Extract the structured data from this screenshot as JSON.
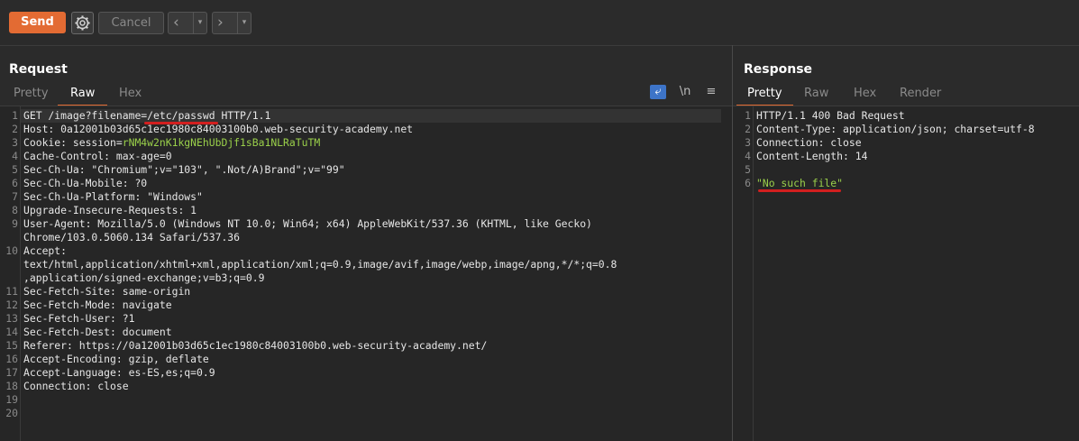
{
  "toolbar": {
    "send_label": "Send",
    "cancel_label": "Cancel",
    "back_icon": "‹",
    "forward_icon": "›",
    "dropdown_icon": "▾"
  },
  "request": {
    "title": "Request",
    "tabs": [
      "Pretty",
      "Raw",
      "Hex"
    ],
    "active_tab": "Raw",
    "icons": {
      "wrap": "⤶",
      "newline": "\\n",
      "menu": "≡"
    },
    "line_numbers": [
      "1",
      "2",
      "3",
      "4",
      "5",
      "6",
      "7",
      "8",
      "9",
      "",
      "10",
      "",
      "",
      "11",
      "12",
      "13",
      "14",
      "15",
      "16",
      "17",
      "18",
      "19",
      "20"
    ],
    "lines": [
      {
        "prefix": "GET /image?filename=",
        "highlight": "/etc/passwd",
        "suffix": " HTTP/1.1"
      },
      {
        "prefix": "Host: 0a12001b03d65c1ec1980c84003100b0.web-security-academy.net"
      },
      {
        "prefix": "Cookie: session=",
        "green": "rNM4w2nK1kgNEhUbDjf1sBa1NLRaTuTM"
      },
      {
        "prefix": "Cache-Control: max-age=0"
      },
      {
        "prefix": "Sec-Ch-Ua: \"Chromium\";v=\"103\", \".Not/A)Brand\";v=\"99\""
      },
      {
        "prefix": "Sec-Ch-Ua-Mobile: ?0"
      },
      {
        "prefix": "Sec-Ch-Ua-Platform: \"Windows\""
      },
      {
        "prefix": "Upgrade-Insecure-Requests: 1"
      },
      {
        "prefix": "User-Agent: Mozilla/5.0 (Windows NT 10.0; Win64; x64) AppleWebKit/537.36 (KHTML, like Gecko)"
      },
      {
        "prefix": "Chrome/103.0.5060.134 Safari/537.36"
      },
      {
        "prefix": "Accept:"
      },
      {
        "prefix": "text/html,application/xhtml+xml,application/xml;q=0.9,image/avif,image/webp,image/apng,*/*;q=0.8"
      },
      {
        "prefix": ",application/signed-exchange;v=b3;q=0.9"
      },
      {
        "prefix": "Sec-Fetch-Site: same-origin"
      },
      {
        "prefix": "Sec-Fetch-Mode: navigate"
      },
      {
        "prefix": "Sec-Fetch-User: ?1"
      },
      {
        "prefix": "Sec-Fetch-Dest: document"
      },
      {
        "prefix": "Referer: https://0a12001b03d65c1ec1980c84003100b0.web-security-academy.net/"
      },
      {
        "prefix": "Accept-Encoding: gzip, deflate"
      },
      {
        "prefix": "Accept-Language: es-ES,es;q=0.9"
      },
      {
        "prefix": "Connection: close"
      },
      {
        "prefix": ""
      },
      {
        "prefix": ""
      }
    ]
  },
  "response": {
    "title": "Response",
    "tabs": [
      "Pretty",
      "Raw",
      "Hex",
      "Render"
    ],
    "active_tab": "Pretty",
    "line_numbers": [
      "1",
      "2",
      "3",
      "4",
      "5",
      "6"
    ],
    "lines": [
      {
        "prefix": "HTTP/1.1 400 Bad Request"
      },
      {
        "prefix": "Content-Type: application/json; charset=utf-8"
      },
      {
        "prefix": "Connection: close"
      },
      {
        "prefix": "Content-Length: 14"
      },
      {
        "prefix": ""
      },
      {
        "green": "\"No such file\""
      }
    ]
  },
  "colors": {
    "accent": "#e36b33",
    "underline": "#d21f1f",
    "string_green": "#9ad04a",
    "icon_blue": "#3d74c8"
  }
}
